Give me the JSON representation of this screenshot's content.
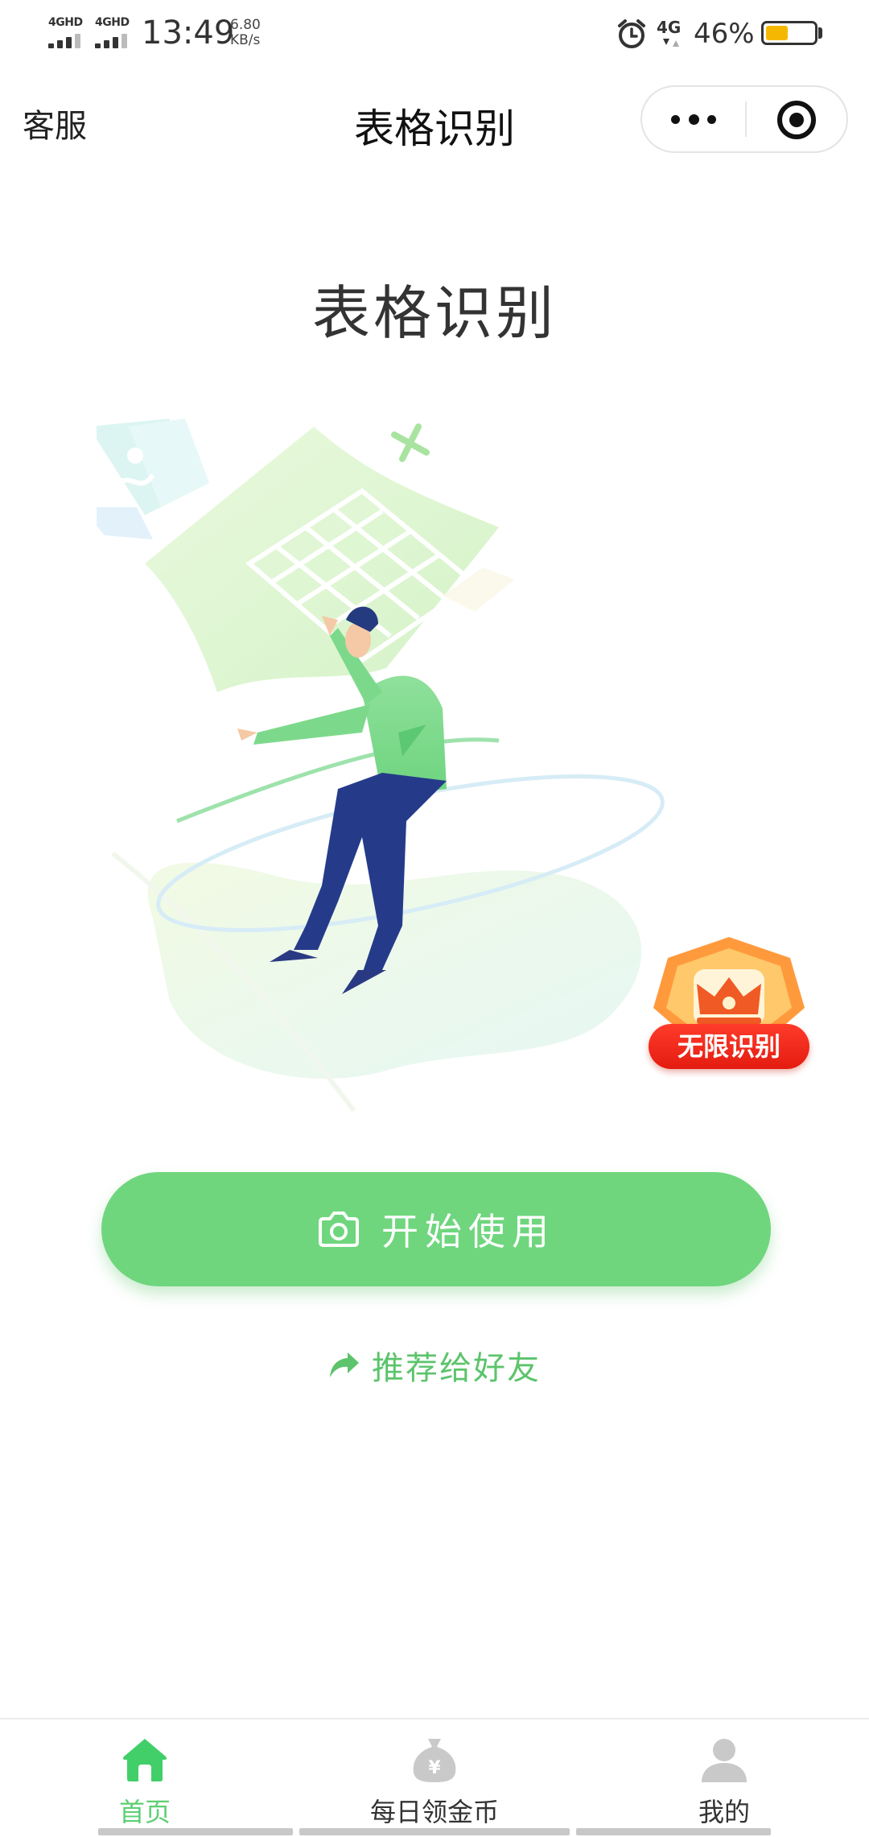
{
  "status_bar": {
    "signal1": "4GHD",
    "signal2": "4GHD",
    "time": "13:49",
    "net_speed_value": "6.80",
    "net_speed_unit": "KB/s",
    "network": "4G",
    "battery_percent": "46%",
    "battery_level": 0.46,
    "battery_color": "#f5b800"
  },
  "nav": {
    "left_label": "客服",
    "title": "表格识别",
    "more_icon": "more-dots-icon",
    "close_icon": "target-circle-icon"
  },
  "main": {
    "heading": "表格识别",
    "hero_illustration": "person-holding-spreadsheet-illustration",
    "badge_label": "无限识别",
    "start_button": {
      "icon": "camera-icon",
      "label": "开始使用"
    },
    "share": {
      "icon": "share-arrow-icon",
      "label": "推荐给好友"
    }
  },
  "tab_bar": {
    "active_color": "#5ccf73",
    "tabs": [
      {
        "label": "首页",
        "icon": "home-icon",
        "active": true
      },
      {
        "label": "每日领金币",
        "icon": "coin-bag-icon",
        "active": false
      },
      {
        "label": "我的",
        "icon": "user-icon",
        "active": false
      }
    ]
  }
}
